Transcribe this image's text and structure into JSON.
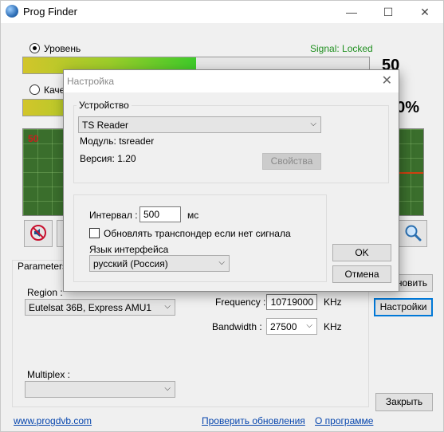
{
  "window": {
    "title": "Prog Finder",
    "minimize_glyph": "—",
    "maximize_glyph": "☐",
    "close_glyph": "✕"
  },
  "signal": {
    "level_label": "Уровень",
    "quality_label": "Каче",
    "status": "Signal: Locked",
    "level_value": "50",
    "quality_value": "00%",
    "level_fraction": 0.5,
    "quality_fraction": 0.5,
    "scope_marker": "50"
  },
  "parameters": {
    "group_label": "Parameters",
    "region_label": "Region :",
    "region_value": "Eutelsat 36B, Express AMU1",
    "frequency_label": "Frequency :",
    "frequency_value": "10719000",
    "frequency_unit": "KHz",
    "bandwidth_label": "Bandwidth :",
    "bandwidth_value": "27500",
    "bandwidth_unit": "KHz",
    "multiplex_label": "Multiplex :",
    "multiplex_value": ""
  },
  "buttons": {
    "refresh": "новить",
    "settings": "Настройки",
    "close": "Закрыть"
  },
  "links": {
    "site": "www.progdvb.com",
    "check_updates": "Проверить обновления",
    "about": "О программе"
  },
  "dialog": {
    "title": "Настройка",
    "device_group": "Устройство",
    "device_value": "TS Reader",
    "module_text": "Модуль: tsreader",
    "version_text": "Версия: 1.20",
    "properties_button": "Свойства",
    "interval_label": "Интервал :",
    "interval_value": "500",
    "interval_unit": "мс",
    "update_checkbox_label": "Обновлять транспондер если нет сигнала",
    "update_checkbox_checked": false,
    "language_label": "Язык интерфейса",
    "language_value": "русский (Россия)",
    "ok_button": "OK",
    "cancel_button": "Отмена"
  },
  "colors": {
    "accent": "#0078d7",
    "status_green": "#1f8f1f",
    "link": "#0645ad",
    "scope_bg": "#3a6e2c",
    "scope_line": "#d04010"
  }
}
